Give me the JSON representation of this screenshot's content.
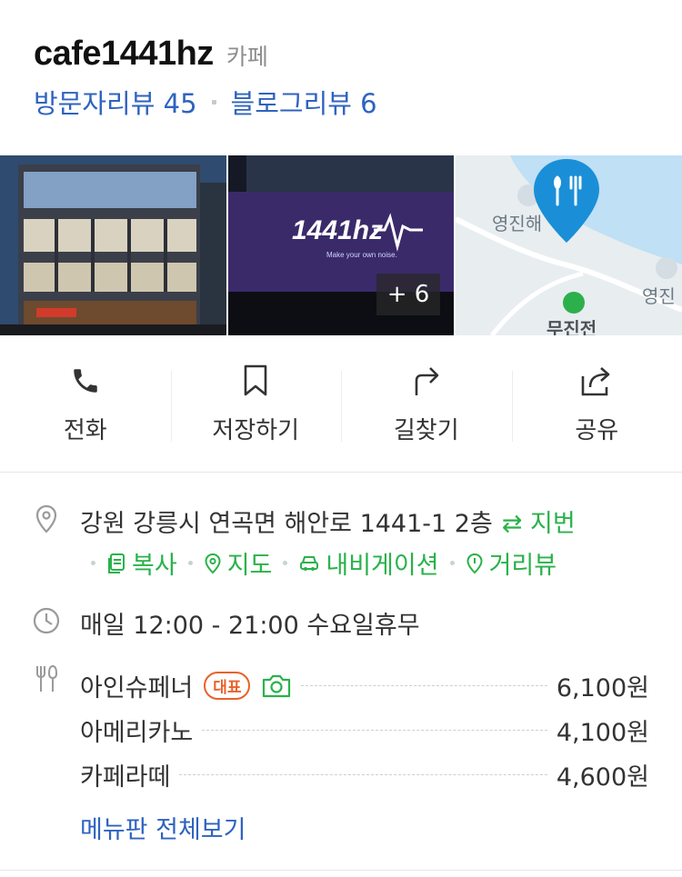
{
  "header": {
    "title": "cafe1441hz",
    "category": "카페",
    "visitor_reviews": "방문자리뷰 45",
    "blog_reviews": "블로그리뷰 6"
  },
  "photos": {
    "sign_text": "1441hz",
    "sign_sub": "Make your own noise.",
    "more_count": "+ 6",
    "map_labels": [
      "영진해",
      "영진",
      "무진전"
    ]
  },
  "actions": [
    {
      "label": "전화",
      "icon": "phone-icon"
    },
    {
      "label": "저장하기",
      "icon": "bookmark-icon"
    },
    {
      "label": "길찾기",
      "icon": "directions-icon"
    },
    {
      "label": "공유",
      "icon": "share-icon"
    }
  ],
  "address": {
    "text": "강원 강릉시 연곡면 해안로 1441-1 2층",
    "jibun": "⇄ 지번",
    "links": [
      "복사",
      "지도",
      "내비게이션",
      "거리뷰"
    ]
  },
  "hours": "매일 12:00 - 21:00 수요일휴무",
  "menu": {
    "items": [
      {
        "name": "아인슈페너",
        "price": "6,100원",
        "badge": "대표"
      },
      {
        "name": "아메리카노",
        "price": "4,100원"
      },
      {
        "name": "카페라떼",
        "price": "4,600원"
      }
    ],
    "view_all": "메뉴판 전체보기"
  },
  "colors": {
    "link_blue": "#2e63c0",
    "green": "#29b24a",
    "badge_orange": "#e8622a",
    "map_pin": "#1a8fd8"
  }
}
